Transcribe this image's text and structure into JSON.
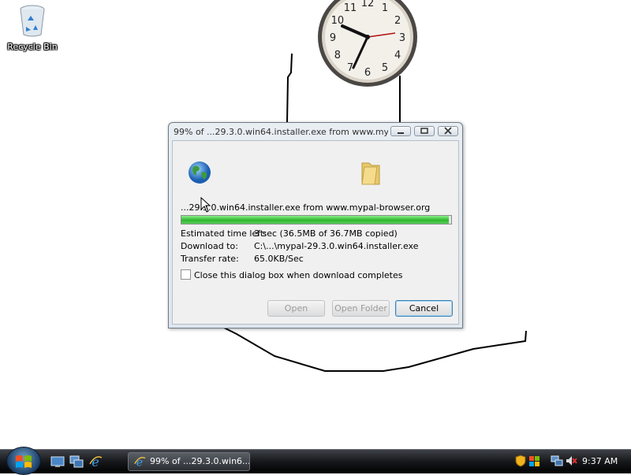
{
  "desktop": {
    "recycle_bin_label": "Recycle Bin"
  },
  "clock_gadget": {
    "numerals": [
      "12",
      "1",
      "2",
      "3",
      "4",
      "5",
      "6",
      "7",
      "8",
      "9",
      "10",
      "11"
    ]
  },
  "dialog": {
    "title": "99% of ...29.3.0.win64.installer.exe from www.myp...",
    "filename_line": "...29.3.0.win64.installer.exe from www.mypal-browser.org",
    "progress_percent": 99,
    "info": [
      {
        "label": "Estimated time left:",
        "value": "3 sec (36.5MB of 36.7MB copied)"
      },
      {
        "label": "Download to:",
        "value": "C:\\...\\mypal-29.3.0.win64.installer.exe"
      },
      {
        "label": "Transfer rate:",
        "value": "65.0KB/Sec"
      }
    ],
    "close_when_done_label": "Close this dialog box when download completes",
    "close_when_done_checked": false,
    "buttons": {
      "open": "Open",
      "open_folder": "Open Folder",
      "cancel": "Cancel"
    }
  },
  "taskbar": {
    "task_label": "99% of ...29.3.0.win6...",
    "time": "9:37 AM"
  },
  "colors": {
    "progress_green": "#2fb62f",
    "taskbar": "#16181b"
  }
}
